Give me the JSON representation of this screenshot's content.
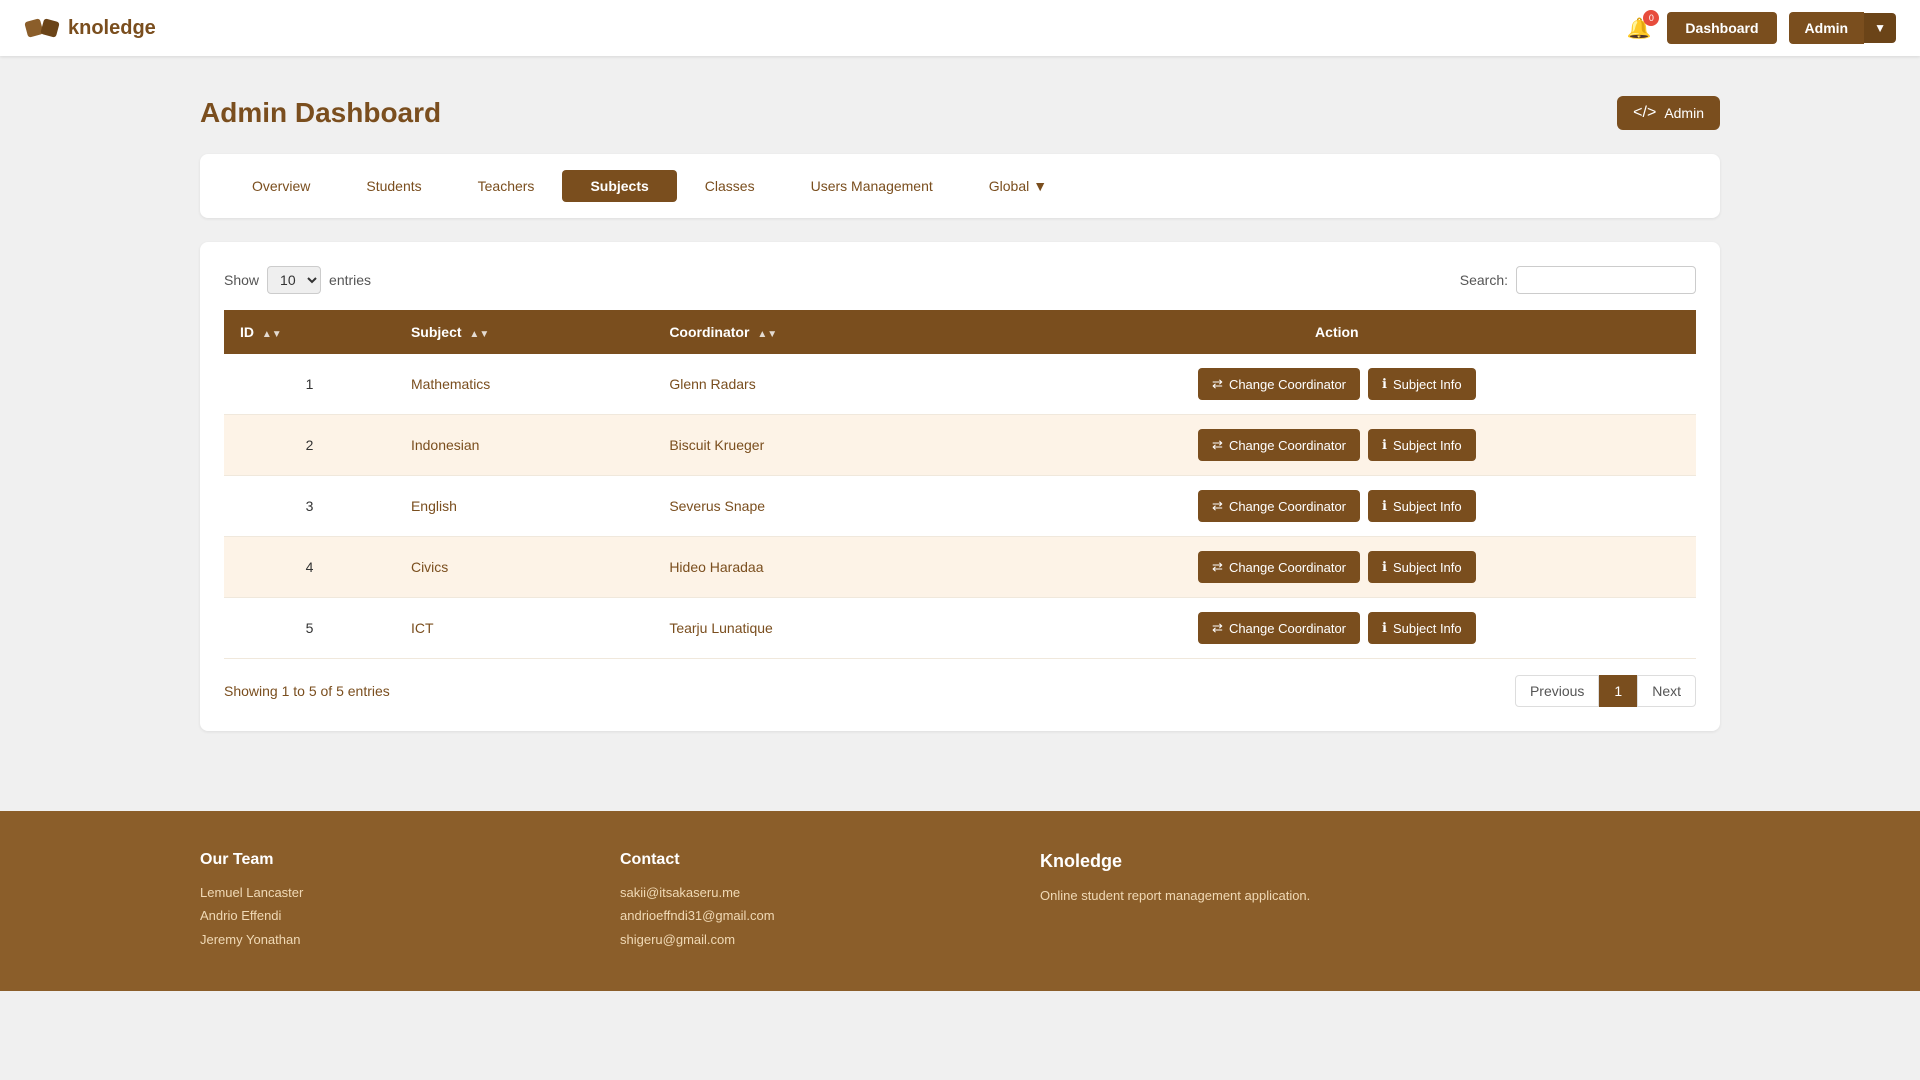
{
  "header": {
    "logo_text": "knoledge",
    "notif_count": "0",
    "dashboard_label": "Dashboard",
    "admin_label": "Admin"
  },
  "page": {
    "title": "Admin Dashboard",
    "role_label": "Admin"
  },
  "nav": {
    "tabs": [
      {
        "label": "Overview",
        "active": false
      },
      {
        "label": "Students",
        "active": false
      },
      {
        "label": "Teachers",
        "active": false
      },
      {
        "label": "Subjects",
        "active": true
      },
      {
        "label": "Classes",
        "active": false
      },
      {
        "label": "Users Management",
        "active": false
      },
      {
        "label": "Global",
        "active": false,
        "dropdown": true
      }
    ]
  },
  "table": {
    "show_label": "Show",
    "show_value": "10",
    "entries_label": "entries",
    "search_label": "Search:",
    "columns": [
      "ID",
      "Subject",
      "Coordinator",
      "Action"
    ],
    "rows": [
      {
        "id": "1",
        "subject": "Mathematics",
        "coordinator": "Glenn Radars"
      },
      {
        "id": "2",
        "subject": "Indonesian",
        "coordinator": "Biscuit Krueger"
      },
      {
        "id": "3",
        "subject": "English",
        "coordinator": "Severus Snape"
      },
      {
        "id": "4",
        "subject": "Civics",
        "coordinator": "Hideo Haradaa"
      },
      {
        "id": "5",
        "subject": "ICT",
        "coordinator": "Tearju Lunatique"
      }
    ],
    "btn_change": "Change Coordinator",
    "btn_info": "Subject Info",
    "showing_text": "Showing 1 to 5 of 5 entries",
    "pagination": {
      "prev": "Previous",
      "pages": [
        "1"
      ],
      "next": "Next"
    }
  },
  "footer": {
    "team_title": "Our Team",
    "team_members": [
      "Lemuel Lancaster",
      "Andrio Effendi",
      "Jeremy Yonathan"
    ],
    "contact_title": "Contact",
    "contact_emails": [
      "sakii@itsakaseru.me",
      "andrioeffndi31@gmail.com",
      "shigeru@gmail.com"
    ],
    "brand_title": "Knoledge",
    "brand_desc": "Online student report management application."
  }
}
